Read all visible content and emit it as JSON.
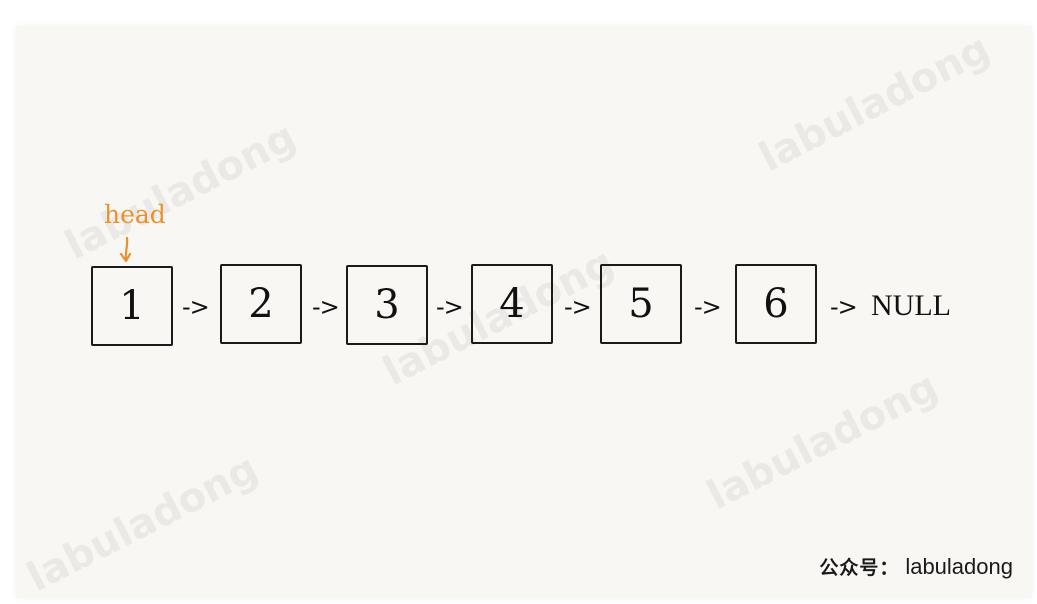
{
  "watermark_text": "labuladong",
  "head_label": "head",
  "arrow_text": "->",
  "null_text": "NULL",
  "nodes": [
    "1",
    "2",
    "3",
    "4",
    "5",
    "6"
  ],
  "footer": {
    "prefix": "公众号：",
    "account": "labuladong"
  },
  "colors": {
    "head": "#e8922f",
    "ink": "#111111",
    "paper": "#f8f7f4"
  }
}
